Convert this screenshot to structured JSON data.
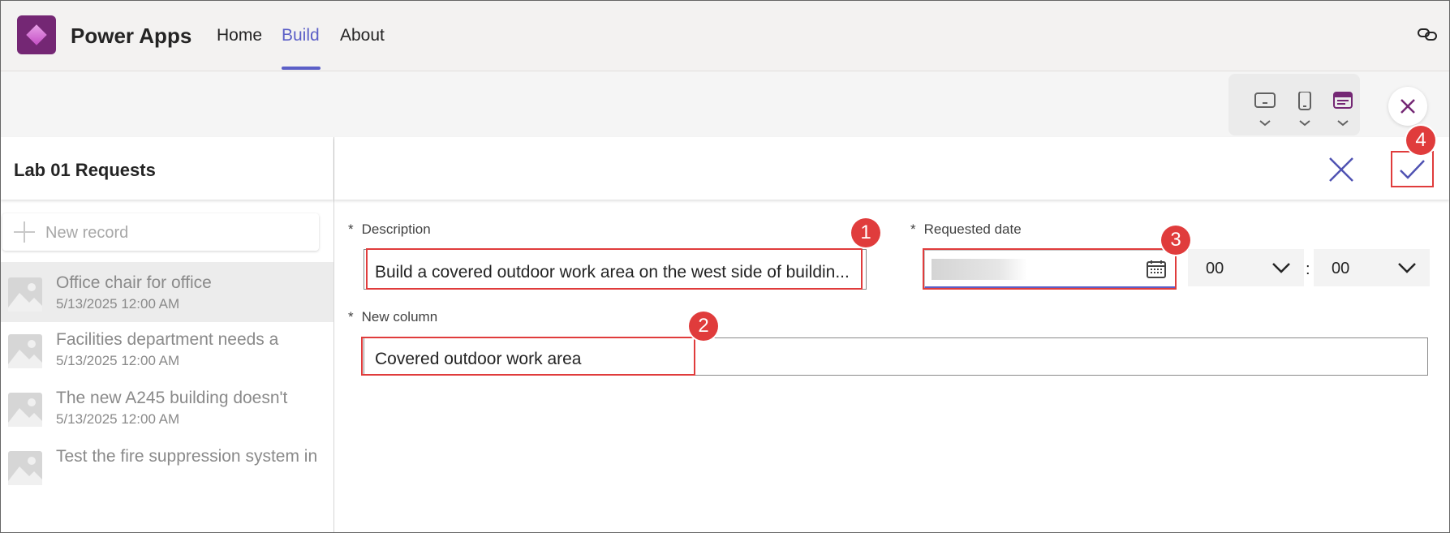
{
  "header": {
    "app_title": "Power Apps",
    "tabs": [
      {
        "label": "Home"
      },
      {
        "label": "Build"
      },
      {
        "label": "About"
      }
    ],
    "active_tab": "Build"
  },
  "list": {
    "title": "Lab 01 Requests",
    "new_record_label": "New record",
    "records": [
      {
        "title": "Office chair for office",
        "date": "5/13/2025 12:00 AM"
      },
      {
        "title": "Facilities department needs a",
        "date": "5/13/2025 12:00 AM"
      },
      {
        "title": "The new A245 building doesn't",
        "date": "5/13/2025 12:00 AM"
      },
      {
        "title": "Test the fire suppression system in",
        "date": ""
      }
    ]
  },
  "form": {
    "description": {
      "required": "*",
      "label": "Description",
      "value": "Build a covered outdoor work area on the west side of buildin..."
    },
    "requested_date": {
      "required": "*",
      "label": "Requested date",
      "value": ""
    },
    "time": {
      "hour": "00",
      "separator": ":",
      "minute": "00"
    },
    "new_column": {
      "required": "*",
      "label": "New column",
      "value": "Covered outdoor work area"
    }
  },
  "annotations": [
    "1",
    "2",
    "3",
    "4"
  ],
  "colors": {
    "brand": "#742774",
    "accent": "#5b5fc7",
    "highlight": "#e03c3c"
  }
}
